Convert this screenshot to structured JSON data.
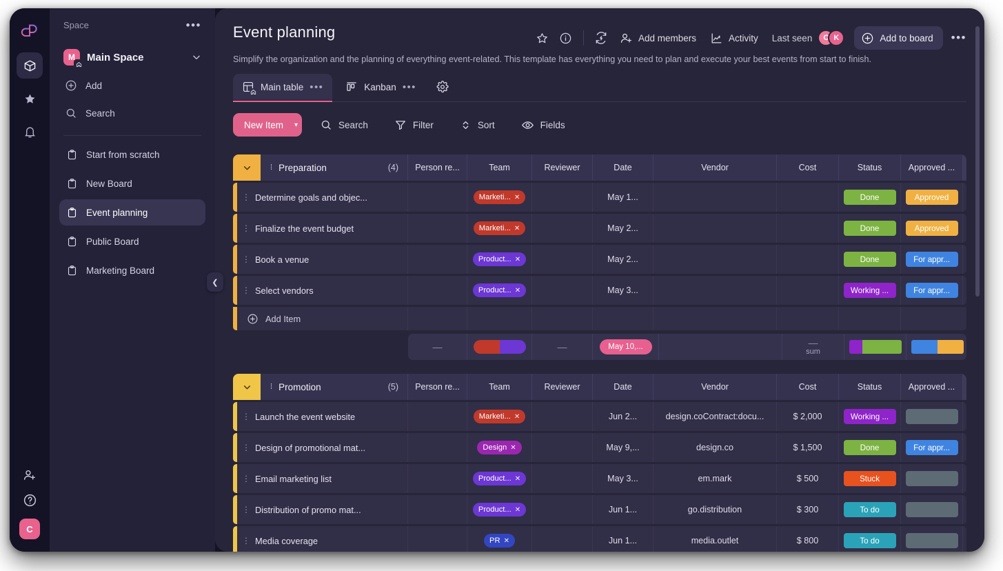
{
  "rail": {
    "logo": "logo-mark",
    "items": [
      {
        "name": "workspace",
        "icon": "cube-icon",
        "active": true
      },
      {
        "name": "favorites",
        "icon": "star-icon",
        "active": false
      },
      {
        "name": "notifications",
        "icon": "bell-icon",
        "active": false
      }
    ],
    "bottom": [
      {
        "name": "invite",
        "icon": "add-person-icon"
      },
      {
        "name": "help",
        "icon": "question-circle-icon"
      }
    ],
    "avatar_initial": "C"
  },
  "sidebar": {
    "section_label": "Space",
    "more_glyph": "•••",
    "space": {
      "initial": "M",
      "name": "Main Space"
    },
    "actions": [
      {
        "label": "Add",
        "icon": "plus-circle-icon"
      },
      {
        "label": "Search",
        "icon": "search-icon"
      }
    ],
    "boards": [
      {
        "label": "Start from scratch",
        "active": false
      },
      {
        "label": "New Board",
        "active": false
      },
      {
        "label": "Event planning",
        "active": true
      },
      {
        "label": "Public Board",
        "active": false
      },
      {
        "label": "Marketing Board",
        "active": false
      }
    ],
    "collapse_glyph": "❮"
  },
  "header": {
    "title": "Event planning",
    "description": "Simplify the organization and the planning of everything event-related. This template has everything you need to plan and execute your best events from start to finish.",
    "star_icon": "star-icon",
    "info_icon": "info-circle-icon",
    "automation_icon": "automation-refresh-icon",
    "add_members_label": "Add members",
    "activity_label": "Activity",
    "last_seen_label": "Last seen",
    "avatars": [
      "C",
      "K"
    ],
    "add_to_board_label": "Add to board",
    "more_glyph": "•••"
  },
  "tabs": [
    {
      "label": "Main table",
      "icon": "table-home-icon",
      "dots": "•••",
      "active": true
    },
    {
      "label": "Kanban",
      "icon": "kanban-icon",
      "dots": "•••",
      "active": false
    }
  ],
  "tab_settings_icon": "gear-icon",
  "toolbar": {
    "new_item_label": "New Item",
    "new_item_caret": "▾",
    "buttons": [
      {
        "label": "Search",
        "icon": "search-icon"
      },
      {
        "label": "Filter",
        "icon": "filter-icon"
      },
      {
        "label": "Sort",
        "icon": "sort-icon"
      },
      {
        "label": "Fields",
        "icon": "eye-icon"
      }
    ]
  },
  "table": {
    "columns": [
      "Person re...",
      "Team",
      "Reviewer",
      "Date",
      "Vendor",
      "Cost",
      "Status",
      "Approved ..."
    ],
    "add_column_icon": "plus-circle-icon",
    "add_item_label": "Add Item",
    "groups": [
      {
        "name": "Preparation",
        "count": "(4)",
        "accent": "#f0b142",
        "rows": [
          {
            "title": "Determine goals and objec...",
            "person": "",
            "team": {
              "label": "Marketi...",
              "color": "#c0392b"
            },
            "reviewer": "",
            "date": "May 1...",
            "vendor": "",
            "cost": "",
            "status": {
              "label": "Done",
              "color": "#7cb342"
            },
            "approved": {
              "label": "Approved",
              "color": "#f0b142"
            }
          },
          {
            "title": "Finalize the event budget",
            "person": "",
            "team": {
              "label": "Marketi...",
              "color": "#c0392b"
            },
            "reviewer": "",
            "date": "May 2...",
            "vendor": "",
            "cost": "",
            "status": {
              "label": "Done",
              "color": "#7cb342"
            },
            "approved": {
              "label": "Approved",
              "color": "#f0b142"
            }
          },
          {
            "title": "Book a venue",
            "person": "",
            "team": {
              "label": "Product...",
              "color": "#6c37d4"
            },
            "reviewer": "",
            "date": "May 2...",
            "vendor": "",
            "cost": "",
            "status": {
              "label": "Done",
              "color": "#7cb342"
            },
            "approved": {
              "label": "For appr...",
              "color": "#3f84e0"
            }
          },
          {
            "title": "Select vendors",
            "person": "",
            "team": {
              "label": "Product...",
              "color": "#6c37d4"
            },
            "reviewer": "",
            "date": "May 3...",
            "vendor": "",
            "cost": "",
            "status": {
              "label": "Working ...",
              "color": "#8e24c9"
            },
            "approved": {
              "label": "For appr...",
              "color": "#3f84e0"
            }
          }
        ],
        "summary": {
          "person": "—",
          "team_segments": [
            {
              "color": "#c0392b",
              "pct": 50
            },
            {
              "color": "#6c37d4",
              "pct": 50
            }
          ],
          "reviewer": "—",
          "date_label": "May 10,...",
          "cost_dash": "—",
          "cost_label": "sum",
          "status_segments": [
            {
              "color": "#8e24c9",
              "pct": 25
            },
            {
              "color": "#7cb342",
              "pct": 75
            }
          ],
          "approved_segments": [
            {
              "color": "#3f84e0",
              "pct": 50
            },
            {
              "color": "#f0b142",
              "pct": 50
            }
          ],
          "kebab": "⋮"
        }
      },
      {
        "name": "Promotion",
        "count": "(5)",
        "accent": "#f0c649",
        "rows": [
          {
            "title": "Launch the event website",
            "person": "",
            "team": {
              "label": "Marketi...",
              "color": "#c0392b"
            },
            "reviewer": "",
            "date": "Jun 2...",
            "vendor": "design.coContract:docu...",
            "cost": "$ 2,000",
            "status": {
              "label": "Working ...",
              "color": "#8e24c9"
            },
            "approved": {
              "label": "",
              "color": "#5d6b74"
            }
          },
          {
            "title": "Design of promotional mat...",
            "person": "",
            "team": {
              "label": "Design",
              "color": "#9b27b0"
            },
            "reviewer": "",
            "date": "May 9,...",
            "vendor": "design.co",
            "cost": "$ 1,500",
            "status": {
              "label": "Done",
              "color": "#7cb342"
            },
            "approved": {
              "label": "For appr...",
              "color": "#3f84e0"
            }
          },
          {
            "title": "Email marketing list",
            "person": "",
            "team": {
              "label": "Product...",
              "color": "#6c37d4"
            },
            "reviewer": "",
            "date": "May 3...",
            "vendor": "em.mark",
            "cost": "$ 500",
            "status": {
              "label": "Stuck",
              "color": "#e8521f"
            },
            "approved": {
              "label": "",
              "color": "#5d6b74"
            }
          },
          {
            "title": "Distribution of promo mat...",
            "person": "",
            "team": {
              "label": "Product...",
              "color": "#6c37d4"
            },
            "reviewer": "",
            "date": "Jun 1...",
            "vendor": "go.distribution",
            "cost": "$ 300",
            "status": {
              "label": "To do",
              "color": "#2aa3b8"
            },
            "approved": {
              "label": "",
              "color": "#5d6b74"
            }
          },
          {
            "title": "Media coverage",
            "person": "",
            "team": {
              "label": "PR",
              "color": "#3246c2"
            },
            "reviewer": "",
            "date": "Jun 1...",
            "vendor": "media.outlet",
            "cost": "$ 800",
            "status": {
              "label": "To do",
              "color": "#2aa3b8"
            },
            "approved": {
              "label": "",
              "color": "#5d6b74"
            }
          }
        ]
      }
    ]
  },
  "colors": {
    "accent_pink": "#e0628a",
    "panel": "#272539",
    "sidebar": "#242238",
    "rail": "#141326",
    "row": "#312e47",
    "header_row": "#353250"
  }
}
